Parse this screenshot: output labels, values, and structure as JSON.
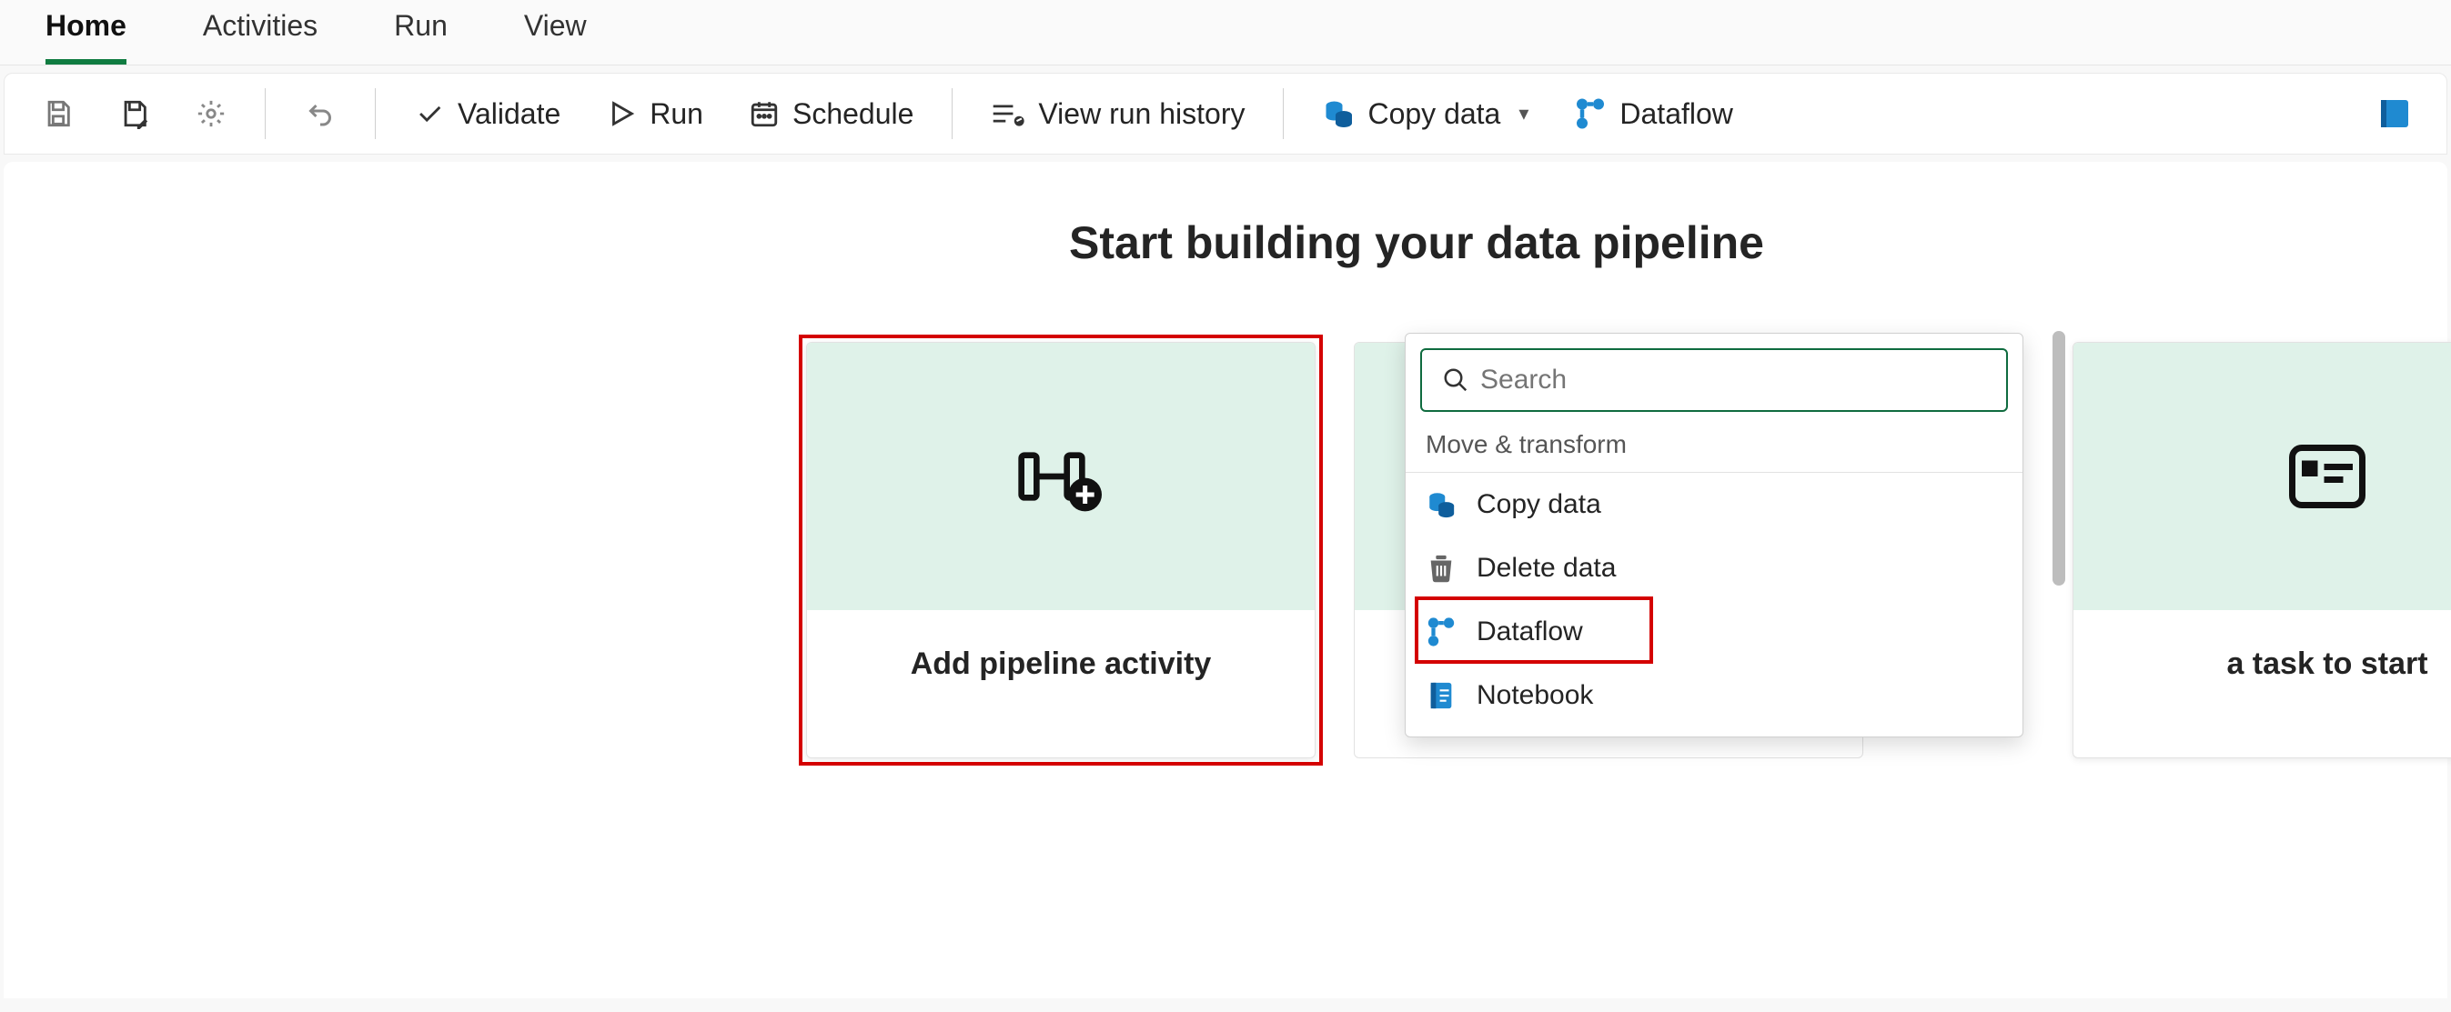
{
  "ribbon": {
    "tabs": [
      "Home",
      "Activities",
      "Run",
      "View"
    ],
    "active": 0
  },
  "toolbar": {
    "validate": "Validate",
    "run": "Run",
    "schedule": "Schedule",
    "view_run_history": "View run history",
    "copy_data": "Copy data",
    "dataflow": "Dataflow"
  },
  "canvas": {
    "headline": "Start building your data pipeline",
    "add_card_label": "Add pipeline activity",
    "template_card_label": "a task to start"
  },
  "dropdown": {
    "search_placeholder": "Search",
    "group_label": "Move & transform",
    "items": [
      {
        "label": "Copy data",
        "icon": "copy-data-icon"
      },
      {
        "label": "Delete data",
        "icon": "trash-icon"
      },
      {
        "label": "Dataflow",
        "icon": "dataflow-icon"
      },
      {
        "label": "Notebook",
        "icon": "notebook-icon"
      }
    ],
    "highlighted_index": 2
  }
}
